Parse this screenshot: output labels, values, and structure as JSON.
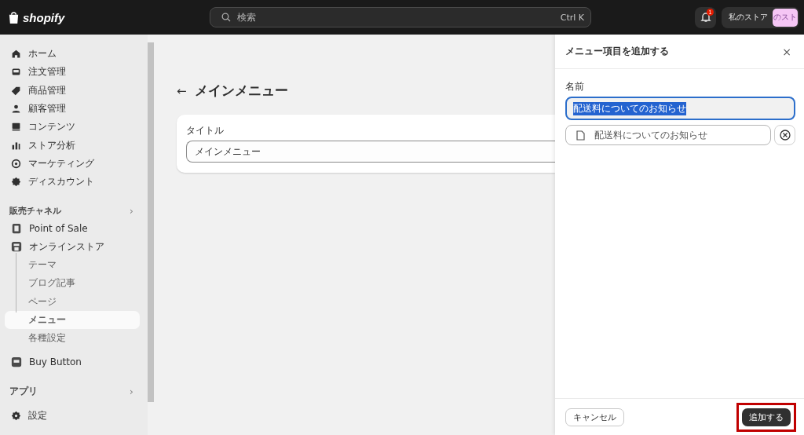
{
  "top_bar": {
    "logo": "shopify",
    "search": {
      "placeholder": "検索",
      "shortcut": "Ctrl K"
    },
    "notifications": {
      "badge": "1"
    },
    "store": {
      "label": "私のストア",
      "avatar": "のスト"
    }
  },
  "sidebar": {
    "items": [
      {
        "label": "ホーム",
        "selected": false
      },
      {
        "label": "注文管理",
        "selected": false
      },
      {
        "label": "商品管理",
        "selected": false
      },
      {
        "label": "顧客管理",
        "selected": false
      },
      {
        "label": "コンテンツ",
        "selected": false
      },
      {
        "label": "ストア分析",
        "selected": false
      },
      {
        "label": "マーケティング",
        "selected": false
      },
      {
        "label": "ディスカウント",
        "selected": false
      }
    ],
    "sales_channels": {
      "title": "販売チャネル",
      "chevron": "›",
      "items": [
        {
          "label": "Point of Sale",
          "selected": false
        },
        {
          "label": "オンラインストア",
          "selected": false,
          "children": [
            {
              "label": "テーマ",
              "selected": false
            },
            {
              "label": "ブログ記事",
              "selected": false
            },
            {
              "label": "ページ",
              "selected": false
            },
            {
              "label": "メニュー",
              "selected": true
            },
            {
              "label": "各種設定",
              "selected": false
            }
          ]
        },
        {
          "label": "Buy Button",
          "selected": false
        }
      ]
    },
    "apps": {
      "title": "アプリ",
      "chevron": "›"
    },
    "settings": {
      "label": "設定",
      "selected": false
    }
  },
  "page": {
    "back": "←",
    "title": "メインメニュー",
    "card": {
      "label": "タイトル",
      "value": "メインメニュー"
    }
  },
  "panel": {
    "title": "メニュー項目を追加する",
    "close": "×",
    "name_label": "名前",
    "name_value": "配送料についてのお知らせ",
    "link_value": "配送料についてのお知らせ",
    "buttons": [
      {
        "label": "キャンセル",
        "kind": "secondary",
        "highlighted": false
      },
      {
        "label": "追加する",
        "kind": "primary",
        "highlighted": true
      }
    ]
  }
}
